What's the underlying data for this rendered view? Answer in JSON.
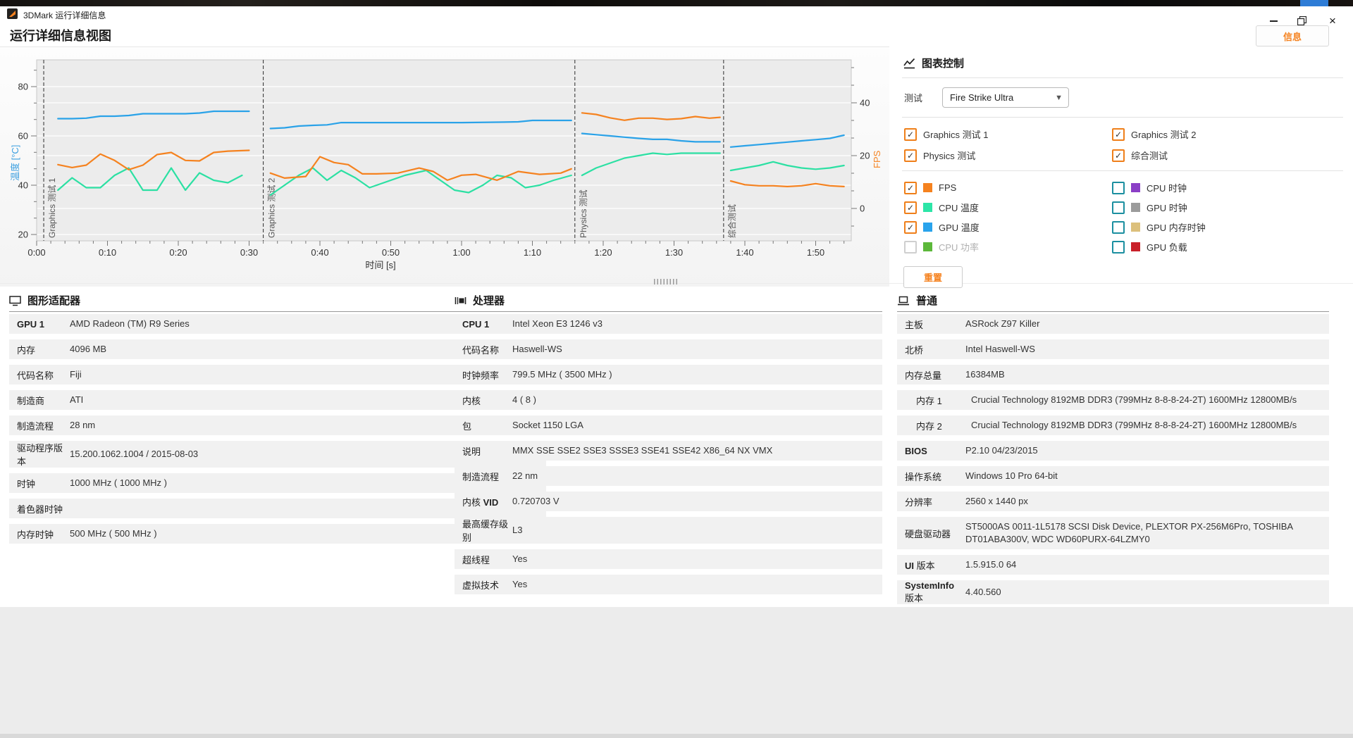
{
  "window": {
    "title": "3DMark 运行详细信息",
    "page_title": "运行详细信息视图",
    "info_button": "信息"
  },
  "chart_controls": {
    "title": "图表控制",
    "test_label": "测试",
    "test_value": "Fire Strike Ultra",
    "reset_label": "重置",
    "test_checkboxes": [
      {
        "label": "Graphics 测试 1",
        "checked": true
      },
      {
        "label": "Graphics 测试 2",
        "checked": true
      },
      {
        "label": "Physics 测试",
        "checked": true
      },
      {
        "label": "综合测试",
        "checked": true
      }
    ],
    "series_checkboxes": [
      {
        "label": "FPS",
        "color": "#f5821f",
        "checked": true,
        "disabled": false
      },
      {
        "label": "CPU 时钟",
        "color": "#8b3fc6",
        "checked": false,
        "disabled": false
      },
      {
        "label": "CPU 温度",
        "color": "#2ce5a7",
        "checked": true,
        "disabled": false
      },
      {
        "label": "GPU 时钟",
        "color": "#9b9b9b",
        "checked": false,
        "disabled": false
      },
      {
        "label": "GPU 温度",
        "color": "#29a3ec",
        "checked": true,
        "disabled": false
      },
      {
        "label": "GPU 内存时钟",
        "color": "#dcc07c",
        "checked": false,
        "disabled": false
      },
      {
        "label": "CPU 功率",
        "color": "#5cb83a",
        "checked": false,
        "disabled": true
      },
      {
        "label": "GPU 负载",
        "color": "#c9202a",
        "checked": false,
        "disabled": false
      }
    ]
  },
  "chart_data": {
    "type": "line",
    "xlabel": "时间 [s]",
    "plot": {
      "l": 52,
      "r": 1208,
      "t": 18,
      "b": 275
    },
    "scales": {
      "time": {
        "x0": 52,
        "pps": 10.05
      },
      "temp": {
        "y0": 266,
        "v0": 20,
        "ppu": 3.5
      },
      "fps": {
        "y0": 229,
        "v0": 0,
        "ppu": 3.75
      }
    },
    "x_axis": {
      "tick_t": [
        0,
        10,
        20,
        30,
        40,
        50,
        60,
        70,
        80,
        90,
        100,
        110
      ],
      "tick_labels": [
        "0:00",
        "0:10",
        "0:20",
        "0:30",
        "0:40",
        "0:50",
        "1:00",
        "1:10",
        "1:20",
        "1:30",
        "1:40",
        "1:50"
      ],
      "minor_step": 2,
      "t_max": 115
    },
    "y_left": {
      "label": "温度 [°C]",
      "color": "#3b9fe0",
      "ticks": [
        20,
        40,
        60,
        80
      ]
    },
    "y_right": {
      "label": "FPS",
      "color": "#f5821f",
      "ticks": [
        0,
        20,
        40
      ]
    },
    "sections": [
      {
        "label": "Graphics 测试 1",
        "t": 1
      },
      {
        "label": "Graphics 测试 2",
        "t": 32
      },
      {
        "label": "Physics 测试",
        "t": 76
      },
      {
        "label": "综合测试",
        "t": 97
      }
    ],
    "series": [
      {
        "name": "CPU 温度",
        "axis": "temp",
        "color": "#2ce0a3",
        "segments": [
          [
            [
              3,
              38
            ],
            [
              5,
              43
            ],
            [
              7,
              39
            ],
            [
              9,
              39
            ],
            [
              11,
              44
            ],
            [
              13,
              47
            ],
            [
              15,
              38
            ],
            [
              17,
              38
            ],
            [
              19,
              47
            ],
            [
              21,
              38
            ],
            [
              23,
              45
            ],
            [
              25,
              42
            ],
            [
              27,
              41
            ],
            [
              29,
              44
            ]
          ],
          [
            [
              33,
              36
            ],
            [
              35,
              40
            ],
            [
              37,
              44
            ],
            [
              39,
              47
            ],
            [
              41,
              42
            ],
            [
              43,
              46
            ],
            [
              45,
              43
            ],
            [
              47,
              39
            ],
            [
              49,
              41
            ],
            [
              52,
              44
            ],
            [
              55,
              46
            ],
            [
              57,
              42
            ],
            [
              59,
              38
            ],
            [
              61,
              37
            ],
            [
              63,
              40
            ],
            [
              65,
              44
            ],
            [
              67,
              43
            ],
            [
              69,
              39
            ],
            [
              71,
              40
            ],
            [
              73,
              42
            ],
            [
              75.5,
              44
            ]
          ],
          [
            [
              77,
              44
            ],
            [
              79,
              47
            ],
            [
              81,
              49
            ],
            [
              83,
              51
            ],
            [
              85,
              52
            ],
            [
              87,
              53
            ],
            [
              89,
              52.5
            ],
            [
              91,
              53
            ],
            [
              93,
              53
            ],
            [
              96.5,
              53
            ]
          ],
          [
            [
              98,
              46
            ],
            [
              100,
              47
            ],
            [
              102,
              48
            ],
            [
              104,
              49.5
            ],
            [
              106,
              48
            ],
            [
              108,
              47
            ],
            [
              110,
              46.5
            ],
            [
              112,
              47
            ],
            [
              114,
              48
            ]
          ]
        ]
      },
      {
        "name": "FPS",
        "axis": "fps",
        "color": "#f5821f",
        "segments": [
          [
            [
              3,
              16.6
            ],
            [
              5,
              15.5
            ],
            [
              7,
              16.4
            ],
            [
              9,
              20.6
            ],
            [
              11,
              18.2
            ],
            [
              13,
              14.7
            ],
            [
              15,
              16.4
            ],
            [
              17,
              20.4
            ],
            [
              19,
              21.2
            ],
            [
              21,
              18.2
            ],
            [
              23,
              18.0
            ],
            [
              25,
              21.2
            ],
            [
              27,
              21.7
            ],
            [
              30,
              22.0
            ]
          ],
          [
            [
              33,
              13.4
            ],
            [
              35,
              11.5
            ],
            [
              38,
              12.1
            ],
            [
              40,
              19.6
            ],
            [
              42,
              17.4
            ],
            [
              44,
              16.6
            ],
            [
              46,
              13.1
            ],
            [
              48,
              13.1
            ],
            [
              51,
              13.4
            ],
            [
              54,
              15.3
            ],
            [
              56,
              14.0
            ],
            [
              58,
              10.7
            ],
            [
              60,
              12.6
            ],
            [
              62,
              12.9
            ],
            [
              65,
              10.7
            ],
            [
              68,
              14.0
            ],
            [
              71,
              12.9
            ],
            [
              74,
              13.4
            ],
            [
              75.5,
              15.0
            ]
          ],
          [
            [
              77,
              36.2
            ],
            [
              79,
              35.6
            ],
            [
              81,
              34.3
            ],
            [
              83,
              33.4
            ],
            [
              85,
              34.2
            ],
            [
              87,
              34.2
            ],
            [
              89,
              33.7
            ],
            [
              91,
              34.0
            ],
            [
              93,
              34.8
            ],
            [
              95,
              34.2
            ],
            [
              96.5,
              34.5
            ]
          ],
          [
            [
              98,
              10.4
            ],
            [
              100,
              9.0
            ],
            [
              102,
              8.6
            ],
            [
              104,
              8.6
            ],
            [
              106,
              8.3
            ],
            [
              108,
              8.6
            ],
            [
              110,
              9.4
            ],
            [
              112,
              8.6
            ],
            [
              114,
              8.3
            ]
          ]
        ]
      },
      {
        "name": "GPU 温度",
        "axis": "temp",
        "color": "#2aa2e8",
        "segments": [
          [
            [
              3,
              67
            ],
            [
              5,
              67
            ],
            [
              7,
              67.2
            ],
            [
              9,
              68
            ],
            [
              11,
              68
            ],
            [
              13,
              68.3
            ],
            [
              15,
              69
            ],
            [
              17,
              69
            ],
            [
              19,
              69
            ],
            [
              21,
              69
            ],
            [
              23,
              69.3
            ],
            [
              25,
              70
            ],
            [
              27,
              70
            ],
            [
              30,
              70
            ]
          ],
          [
            [
              33,
              63
            ],
            [
              35,
              63.3
            ],
            [
              37,
              64
            ],
            [
              39,
              64.3
            ],
            [
              41,
              64.5
            ],
            [
              43,
              65.4
            ],
            [
              48,
              65.4
            ],
            [
              54,
              65.4
            ],
            [
              60,
              65.4
            ],
            [
              66,
              65.6
            ],
            [
              68,
              65.7
            ],
            [
              70,
              66.3
            ],
            [
              75.5,
              66.3
            ]
          ],
          [
            [
              77,
              61
            ],
            [
              79,
              60.5
            ],
            [
              81,
              60
            ],
            [
              83,
              59.5
            ],
            [
              85,
              59
            ],
            [
              87,
              58.6
            ],
            [
              89,
              58.6
            ],
            [
              91,
              58
            ],
            [
              93,
              57.6
            ],
            [
              96.5,
              57.6
            ]
          ],
          [
            [
              98,
              55.5
            ],
            [
              100,
              56
            ],
            [
              102,
              56.5
            ],
            [
              104,
              57
            ],
            [
              106,
              57.5
            ],
            [
              108,
              58
            ],
            [
              110,
              58.5
            ],
            [
              112,
              59
            ],
            [
              114,
              60.3
            ]
          ]
        ]
      }
    ]
  },
  "tables": [
    {
      "title": "图形适配器",
      "rows": [
        {
          "label": [
            [
              "GPU 1",
              true
            ]
          ],
          "value": "AMD Radeon (TM) R9 Series"
        },
        {
          "label": [
            [
              "内存",
              false
            ]
          ],
          "value": "4096 MB"
        },
        {
          "label": [
            [
              "代码名称",
              false
            ]
          ],
          "value": "Fiji"
        },
        {
          "label": [
            [
              "制造商",
              false
            ]
          ],
          "value": "ATI"
        },
        {
          "label": [
            [
              "制造流程",
              false
            ]
          ],
          "value": "28 nm"
        },
        {
          "label": [
            [
              "驱动程序版本",
              false
            ]
          ],
          "value": "15.200.1062.1004 / 2015-08-03"
        },
        {
          "label": [
            [
              "时钟",
              false
            ]
          ],
          "value": "1000 MHz ( 1000 MHz )"
        },
        {
          "label": [
            [
              "着色器时钟",
              false
            ]
          ],
          "value": ""
        },
        {
          "label": [
            [
              "内存时钟",
              false
            ]
          ],
          "value": "500 MHz ( 500 MHz )"
        }
      ]
    },
    {
      "title": "处理器",
      "rows": [
        {
          "label": [
            [
              "CPU 1",
              true
            ]
          ],
          "value": "Intel Xeon E3 1246 v3"
        },
        {
          "label": [
            [
              "代码名称",
              false
            ]
          ],
          "value": "Haswell-WS"
        },
        {
          "label": [
            [
              "时钟频率",
              false
            ]
          ],
          "value": "799.5 MHz ( 3500 MHz )"
        },
        {
          "label": [
            [
              "内核",
              false
            ]
          ],
          "value": "4 ( 8 )"
        },
        {
          "label": [
            [
              "包",
              false
            ]
          ],
          "value": "Socket 1150 LGA"
        },
        {
          "label": [
            [
              "说明",
              false
            ]
          ],
          "value": "MMX SSE SSE2 SSE3 SSSE3 SSE41 SSE42 X86_64 NX VMX"
        },
        {
          "label": [
            [
              "制造流程",
              false
            ]
          ],
          "value": "22 nm"
        },
        {
          "label": [
            [
              "内核 ",
              false
            ],
            [
              "VID",
              true
            ]
          ],
          "value": "0.720703 V"
        },
        {
          "label": [
            [
              "最高缓存级别",
              false
            ]
          ],
          "value": "L3"
        },
        {
          "label": [
            [
              "超线程",
              false
            ]
          ],
          "value": "Yes"
        },
        {
          "label": [
            [
              "虚拟技术",
              false
            ]
          ],
          "value": "Yes"
        }
      ]
    },
    {
      "title": "普通",
      "rows": [
        {
          "label": [
            [
              "主板",
              false
            ]
          ],
          "value": "ASRock Z97 Killer"
        },
        {
          "label": [
            [
              "北桥",
              false
            ]
          ],
          "value": "Intel Haswell-WS"
        },
        {
          "label": [
            [
              "内存总量",
              false
            ]
          ],
          "value": "16384MB"
        },
        {
          "label": [
            [
              "内存 1",
              false
            ]
          ],
          "value": "Crucial Technology 8192MB DDR3 (799MHz 8-8-8-24-2T) 1600MHz 12800MB/s",
          "indent": true
        },
        {
          "label": [
            [
              "内存 2",
              false
            ]
          ],
          "value": "Crucial Technology 8192MB DDR3 (799MHz 8-8-8-24-2T) 1600MHz 12800MB/s",
          "indent": true
        },
        {
          "label": [
            [
              "BIOS",
              true
            ]
          ],
          "value": "P2.10 04/23/2015"
        },
        {
          "label": [
            [
              "操作系统",
              false
            ]
          ],
          "value": "Windows 10 Pro 64-bit"
        },
        {
          "label": [
            [
              "分辨率",
              false
            ]
          ],
          "value": "2560 x 1440 px"
        },
        {
          "label": [
            [
              "硬盘驱动器",
              false
            ]
          ],
          "value": "ST5000AS 0011-1L5178 SCSI Disk Device, PLEXTOR PX-256M6Pro, TOSHIBA DT01ABA300V, WDC WD60PURX-64LZMY0",
          "tall": true
        },
        {
          "label": [
            [
              "UI ",
              true
            ],
            [
              "版本",
              false
            ]
          ],
          "value": "1.5.915.0 64"
        },
        {
          "label": [
            [
              "SystemInfo ",
              true
            ],
            [
              "版本",
              false
            ]
          ],
          "value": "4.40.560"
        }
      ]
    }
  ]
}
